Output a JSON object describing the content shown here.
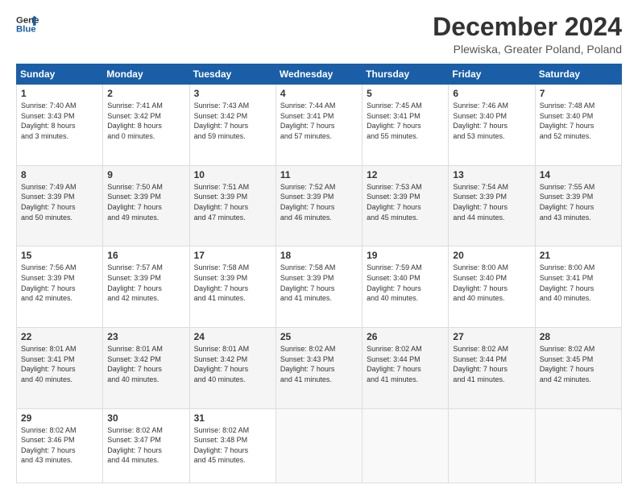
{
  "header": {
    "logo_line1": "General",
    "logo_line2": "Blue",
    "title": "December 2024",
    "subtitle": "Plewiska, Greater Poland, Poland"
  },
  "weekdays": [
    "Sunday",
    "Monday",
    "Tuesday",
    "Wednesday",
    "Thursday",
    "Friday",
    "Saturday"
  ],
  "weeks": [
    [
      {
        "day": "1",
        "sunrise": "7:40 AM",
        "sunset": "3:43 PM",
        "daylight_hours": "8",
        "daylight_minutes": "3"
      },
      {
        "day": "2",
        "sunrise": "7:41 AM",
        "sunset": "3:42 PM",
        "daylight_hours": "8",
        "daylight_minutes": "0"
      },
      {
        "day": "3",
        "sunrise": "7:43 AM",
        "sunset": "3:42 PM",
        "daylight_hours": "7",
        "daylight_minutes": "59"
      },
      {
        "day": "4",
        "sunrise": "7:44 AM",
        "sunset": "3:41 PM",
        "daylight_hours": "7",
        "daylight_minutes": "57"
      },
      {
        "day": "5",
        "sunrise": "7:45 AM",
        "sunset": "3:41 PM",
        "daylight_hours": "7",
        "daylight_minutes": "55"
      },
      {
        "day": "6",
        "sunrise": "7:46 AM",
        "sunset": "3:40 PM",
        "daylight_hours": "7",
        "daylight_minutes": "53"
      },
      {
        "day": "7",
        "sunrise": "7:48 AM",
        "sunset": "3:40 PM",
        "daylight_hours": "7",
        "daylight_minutes": "52"
      }
    ],
    [
      {
        "day": "8",
        "sunrise": "7:49 AM",
        "sunset": "3:39 PM",
        "daylight_hours": "7",
        "daylight_minutes": "50"
      },
      {
        "day": "9",
        "sunrise": "7:50 AM",
        "sunset": "3:39 PM",
        "daylight_hours": "7",
        "daylight_minutes": "49"
      },
      {
        "day": "10",
        "sunrise": "7:51 AM",
        "sunset": "3:39 PM",
        "daylight_hours": "7",
        "daylight_minutes": "47"
      },
      {
        "day": "11",
        "sunrise": "7:52 AM",
        "sunset": "3:39 PM",
        "daylight_hours": "7",
        "daylight_minutes": "46"
      },
      {
        "day": "12",
        "sunrise": "7:53 AM",
        "sunset": "3:39 PM",
        "daylight_hours": "7",
        "daylight_minutes": "45"
      },
      {
        "day": "13",
        "sunrise": "7:54 AM",
        "sunset": "3:39 PM",
        "daylight_hours": "7",
        "daylight_minutes": "44"
      },
      {
        "day": "14",
        "sunrise": "7:55 AM",
        "sunset": "3:39 PM",
        "daylight_hours": "7",
        "daylight_minutes": "43"
      }
    ],
    [
      {
        "day": "15",
        "sunrise": "7:56 AM",
        "sunset": "3:39 PM",
        "daylight_hours": "7",
        "daylight_minutes": "42"
      },
      {
        "day": "16",
        "sunrise": "7:57 AM",
        "sunset": "3:39 PM",
        "daylight_hours": "7",
        "daylight_minutes": "42"
      },
      {
        "day": "17",
        "sunrise": "7:58 AM",
        "sunset": "3:39 PM",
        "daylight_hours": "7",
        "daylight_minutes": "41"
      },
      {
        "day": "18",
        "sunrise": "7:58 AM",
        "sunset": "3:39 PM",
        "daylight_hours": "7",
        "daylight_minutes": "41"
      },
      {
        "day": "19",
        "sunrise": "7:59 AM",
        "sunset": "3:40 PM",
        "daylight_hours": "7",
        "daylight_minutes": "40"
      },
      {
        "day": "20",
        "sunrise": "8:00 AM",
        "sunset": "3:40 PM",
        "daylight_hours": "7",
        "daylight_minutes": "40"
      },
      {
        "day": "21",
        "sunrise": "8:00 AM",
        "sunset": "3:41 PM",
        "daylight_hours": "7",
        "daylight_minutes": "40"
      }
    ],
    [
      {
        "day": "22",
        "sunrise": "8:01 AM",
        "sunset": "3:41 PM",
        "daylight_hours": "7",
        "daylight_minutes": "40"
      },
      {
        "day": "23",
        "sunrise": "8:01 AM",
        "sunset": "3:42 PM",
        "daylight_hours": "7",
        "daylight_minutes": "40"
      },
      {
        "day": "24",
        "sunrise": "8:01 AM",
        "sunset": "3:42 PM",
        "daylight_hours": "7",
        "daylight_minutes": "40"
      },
      {
        "day": "25",
        "sunrise": "8:02 AM",
        "sunset": "3:43 PM",
        "daylight_hours": "7",
        "daylight_minutes": "41"
      },
      {
        "day": "26",
        "sunrise": "8:02 AM",
        "sunset": "3:44 PM",
        "daylight_hours": "7",
        "daylight_minutes": "41"
      },
      {
        "day": "27",
        "sunrise": "8:02 AM",
        "sunset": "3:44 PM",
        "daylight_hours": "7",
        "daylight_minutes": "41"
      },
      {
        "day": "28",
        "sunrise": "8:02 AM",
        "sunset": "3:45 PM",
        "daylight_hours": "7",
        "daylight_minutes": "42"
      }
    ],
    [
      {
        "day": "29",
        "sunrise": "8:02 AM",
        "sunset": "3:46 PM",
        "daylight_hours": "7",
        "daylight_minutes": "43"
      },
      {
        "day": "30",
        "sunrise": "8:02 AM",
        "sunset": "3:47 PM",
        "daylight_hours": "7",
        "daylight_minutes": "44"
      },
      {
        "day": "31",
        "sunrise": "8:02 AM",
        "sunset": "3:48 PM",
        "daylight_hours": "7",
        "daylight_minutes": "45"
      },
      null,
      null,
      null,
      null
    ]
  ],
  "labels": {
    "sunrise_prefix": "Sunrise: ",
    "sunset_prefix": "Sunset: ",
    "daylight_prefix": "Daylight: ",
    "hours_suffix": " hours",
    "and_minutes_prefix": "and ",
    "minutes_suffix": " minutes."
  }
}
